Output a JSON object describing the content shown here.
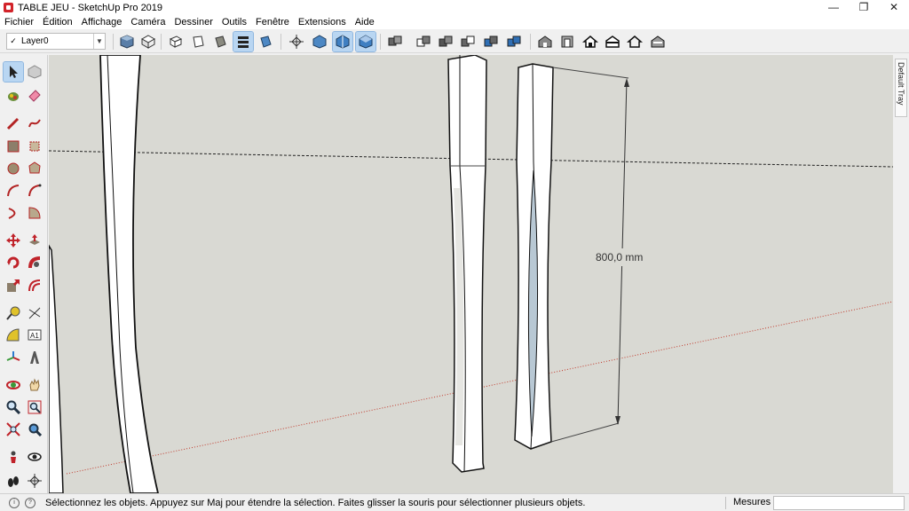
{
  "window": {
    "title": "TABLE JEU - SketchUp Pro 2019",
    "minimize_glyph": "—",
    "maximize_glyph": "❐",
    "close_glyph": "✕"
  },
  "menu": [
    "Fichier",
    "Édition",
    "Affichage",
    "Caméra",
    "Dessiner",
    "Outils",
    "Fenêtre",
    "Extensions",
    "Aide"
  ],
  "toolbar": {
    "layer_check": "✓",
    "layer_name": "Layer0",
    "layer_arrow": "▼",
    "buttons": [
      "iso-view-icon",
      "top-view-icon",
      "front-view-icon",
      "right-view-icon",
      "back-view-icon",
      "left-view-icon",
      "xray-style-icon",
      "wireframe-style-icon",
      "section-plane-icon",
      "section-cut-icon",
      "component-icon",
      "group-icon",
      "solid-union-icon",
      "solid-subtract-icon",
      "solid-trim-icon",
      "solid-split-icon",
      "warehouse-icon",
      "extension-icon",
      "house-icon",
      "house-outline-icon",
      "house-share-icon",
      "house-export-icon"
    ]
  },
  "tools": [
    "select-icon",
    "make-component-icon",
    "paint-bucket-icon",
    "eraser-icon",
    "pencil-icon",
    "freehand-icon",
    "rectangle-icon",
    "rotated-rectangle-icon",
    "circle-icon",
    "polygon-icon",
    "arc-icon",
    "two-point-arc-icon",
    "three-point-arc-icon",
    "pie-icon",
    "move-icon",
    "push-pull-icon",
    "rotate-icon",
    "follow-me-icon",
    "scale-icon",
    "offset-icon",
    "tape-measure-icon",
    "dimension-icon",
    "protractor-icon",
    "text-icon",
    "axes-icon",
    "3d-text-icon",
    "orbit-icon",
    "pan-icon",
    "zoom-icon",
    "zoom-window-icon",
    "zoom-extents-icon",
    "previous-view-icon",
    "position-camera-icon",
    "look-around-icon",
    "walk-icon",
    "section-plane-tool-icon"
  ],
  "text_tool_glyph": "A1",
  "viewport": {
    "dimension_label": "800,0 mm",
    "background": "#d9d9d3"
  },
  "tray": {
    "label": "Default Tray"
  },
  "status": {
    "icon1_glyph": "i",
    "icon2_glyph": "?",
    "message": "Sélectionnez les objets. Appuyez sur Maj pour étendre la sélection. Faites glisser la souris pour sélectionner plusieurs objets.",
    "measure_label": "Mesures",
    "measure_value": ""
  },
  "colors": {
    "active_highlight": "#b9d6f2",
    "red_axis": "#c0392b",
    "section_fill": "#b8c8d4"
  }
}
